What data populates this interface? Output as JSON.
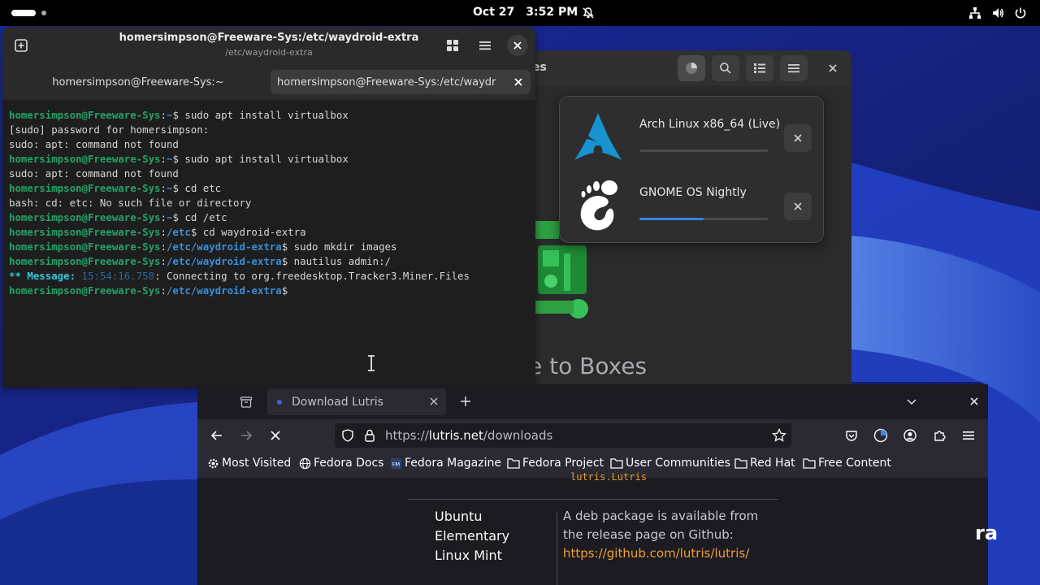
{
  "topbar": {
    "date": "Oct 27",
    "time": "3:52 PM",
    "icons": [
      "notifications-off-icon",
      "network-icon",
      "volume-icon",
      "power-icon"
    ]
  },
  "boxes": {
    "title_partial": "xes",
    "welcome_partial": "e to Boxes",
    "downloads": [
      {
        "name": "Arch Linux x86_64 (Live)",
        "progress": 0.0
      },
      {
        "name": "GNOME OS Nightly",
        "progress": 0.5
      }
    ]
  },
  "terminal": {
    "title": "homersimpson@Freeware-Sys:/etc/waydroid-extra",
    "subtitle": "/etc/waydroid-extra",
    "tabs": [
      {
        "label": "homersimpson@Freeware-Sys:~",
        "active": false
      },
      {
        "label": "homersimpson@Freeware-Sys:/etc/waydr",
        "active": true
      }
    ],
    "lines": [
      {
        "user": "homersimpson@Freeware-Sys",
        "path": "~",
        "cmd": " sudo apt install virtualbox"
      },
      {
        "text": "[sudo] password for homersimpson:"
      },
      {
        "text": "sudo: apt: command not found"
      },
      {
        "user": "homersimpson@Freeware-Sys",
        "path": "~",
        "cmd": " sudo apt install virtualbox"
      },
      {
        "text": "sudo: apt: command not found"
      },
      {
        "user": "homersimpson@Freeware-Sys",
        "path": "~",
        "cmd": " cd etc"
      },
      {
        "text": "bash: cd: etc: No such file or directory"
      },
      {
        "user": "homersimpson@Freeware-Sys",
        "path": "~",
        "cmd": " cd /etc"
      },
      {
        "user": "homersimpson@Freeware-Sys",
        "path": "/etc",
        "cmd": " cd waydroid-extra"
      },
      {
        "user": "homersimpson@Freeware-Sys",
        "path": "/etc/waydroid-extra",
        "cmd": " sudo mkdir images"
      },
      {
        "user": "homersimpson@Freeware-Sys",
        "path": "/etc/waydroid-extra",
        "cmd": " nautilus admin:/"
      },
      {
        "msg": "** Message:",
        "time": "15:54:16.758",
        "rest": ": Connecting to org.freedesktop.Tracker3.Miner.Files"
      },
      {
        "user": "homersimpson@Freeware-Sys",
        "path": "/etc/waydroid-extra",
        "cmd": ""
      }
    ]
  },
  "firefox": {
    "tab_title": "Download Lutris",
    "url_prefix": "https://",
    "url_domain": "lutris.net",
    "url_path": "/downloads",
    "bookmarks": [
      {
        "label": "Most Visited",
        "icon": "gear-icon"
      },
      {
        "label": "Fedora Docs",
        "icon": "globe-icon"
      },
      {
        "label": "Fedora Magazine",
        "icon": "fm-icon"
      },
      {
        "label": "Fedora Project",
        "icon": "folder-icon"
      },
      {
        "label": "User Communities",
        "icon": "folder-icon"
      },
      {
        "label": "Red Hat",
        "icon": "folder-icon"
      },
      {
        "label": "Free Content",
        "icon": "folder-icon"
      }
    ],
    "content": {
      "code_partial": "lutris.Lutris",
      "distros": [
        "Ubuntu",
        "Elementary",
        "Linux Mint"
      ],
      "desc_line1": "A deb package is available from",
      "desc_line2": "the release page on Github:",
      "link": "https://github.com/lutris/lutris/"
    }
  },
  "desktop": {
    "overlay_partial": "ra"
  },
  "colors": {
    "terminal_user": "#26a269",
    "terminal_path": "#3a8fd6",
    "progress_accent": "#3584e4",
    "link_orange": "#f0a030"
  }
}
